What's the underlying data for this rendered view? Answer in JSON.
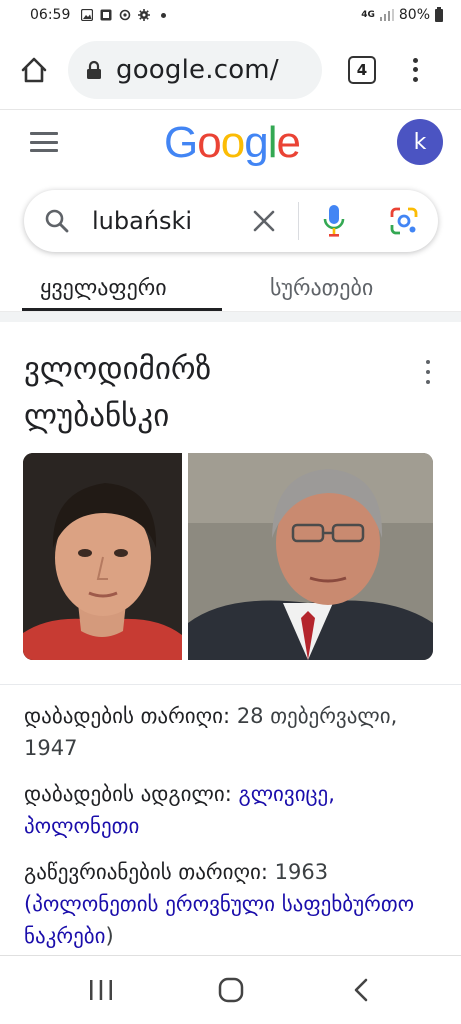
{
  "status_bar": {
    "time": "06:59",
    "network": "4G",
    "battery": "80%"
  },
  "browser": {
    "url": "google.com/",
    "tab_count": "4"
  },
  "google": {
    "logo_letters": [
      "G",
      "o",
      "o",
      "g",
      "l",
      "e"
    ],
    "logo_colors": [
      "#4285F4",
      "#EA4335",
      "#FBBC05",
      "#4285F4",
      "#34A853",
      "#EA4335"
    ],
    "avatar_letter": "k",
    "avatar_color": "#4b54c2"
  },
  "search": {
    "query": "lubański"
  },
  "tabs": [
    {
      "label": "ყველაფერი",
      "active": true
    },
    {
      "label": "სურათები",
      "active": false
    }
  ],
  "knowledge_panel": {
    "title_line1": "ვლოდიმირზ",
    "title_line2": "ლუბანსკი",
    "facts": {
      "birth_date_label": "დაბადების თარიღი:",
      "birth_date_value": "28 თებერვალი, 1947",
      "birth_place_label": "დაბადების ადგილი:",
      "birth_place_value": "გლივიცე, პოლონეთი",
      "debut_label": "გაწევრიანების თარიღი:",
      "debut_value": "1963",
      "debut_open": "(",
      "debut_team": "პოლონეთის ეროვნული საფეხბურთო ნაკრები",
      "debut_close": ")"
    }
  }
}
